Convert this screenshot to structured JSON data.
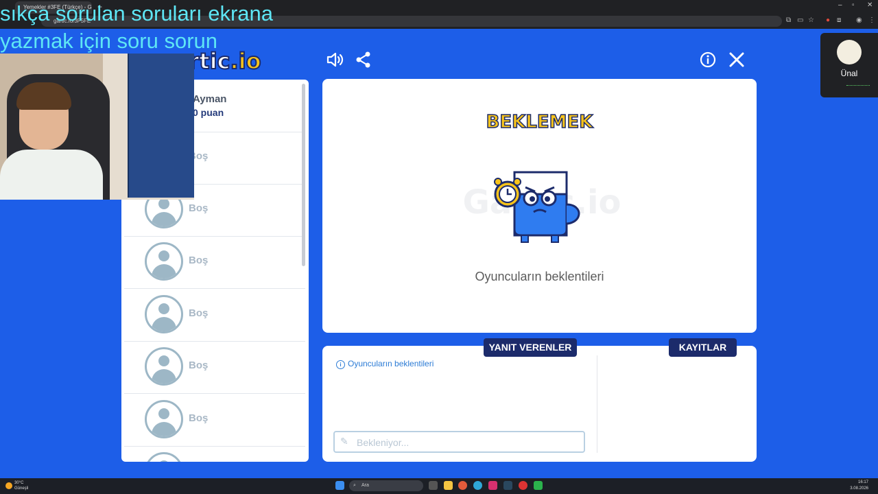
{
  "browser": {
    "tab_title": "Yemekler #3FE (Türkçe) - Gar…",
    "url": "gartic.io/3F5FE",
    "new_tab": "+"
  },
  "overlay": {
    "line1": "sıkça sorulan soruları ekrana",
    "line2": "yazmak  için soru sorun"
  },
  "game": {
    "logo_main": "gartic",
    "logo_accent": ".io",
    "players": [
      {
        "name": "Ayman",
        "points": "0 puan"
      },
      {
        "name": "Boş"
      },
      {
        "name": "Boş"
      },
      {
        "name": "Boş"
      },
      {
        "name": "Boş"
      },
      {
        "name": "Boş"
      },
      {
        "name": "Boş"
      },
      {
        "name": ""
      }
    ],
    "status_title": "BEKLEMEK",
    "watermark": "Gartic.io",
    "status_message": "Oyuncuların beklentileri",
    "answers_label": "YANIT VERENLER",
    "logs_label": "KAYITLAR",
    "answers_info": "Oyuncuların beklentileri",
    "answer_placeholder": "Bekleniyor..."
  },
  "meet": {
    "participant": "Ünal"
  },
  "taskbar": {
    "temperature": "30°C",
    "weather": "Güneşli",
    "search": "Ara",
    "time": "16:17",
    "date": "3.08.2026"
  },
  "colors": {
    "background": "#1d5ee8",
    "accent_yellow": "#f7c31b",
    "navy": "#1c2b6b",
    "overlay_cyan": "#5ee6f5"
  },
  "icons": [
    "sound-icon",
    "share-icon",
    "info-icon",
    "close-icon",
    "pencil-icon",
    "avatar-icon",
    "clock-icon",
    "search-icon",
    "windows-start-icon"
  ]
}
